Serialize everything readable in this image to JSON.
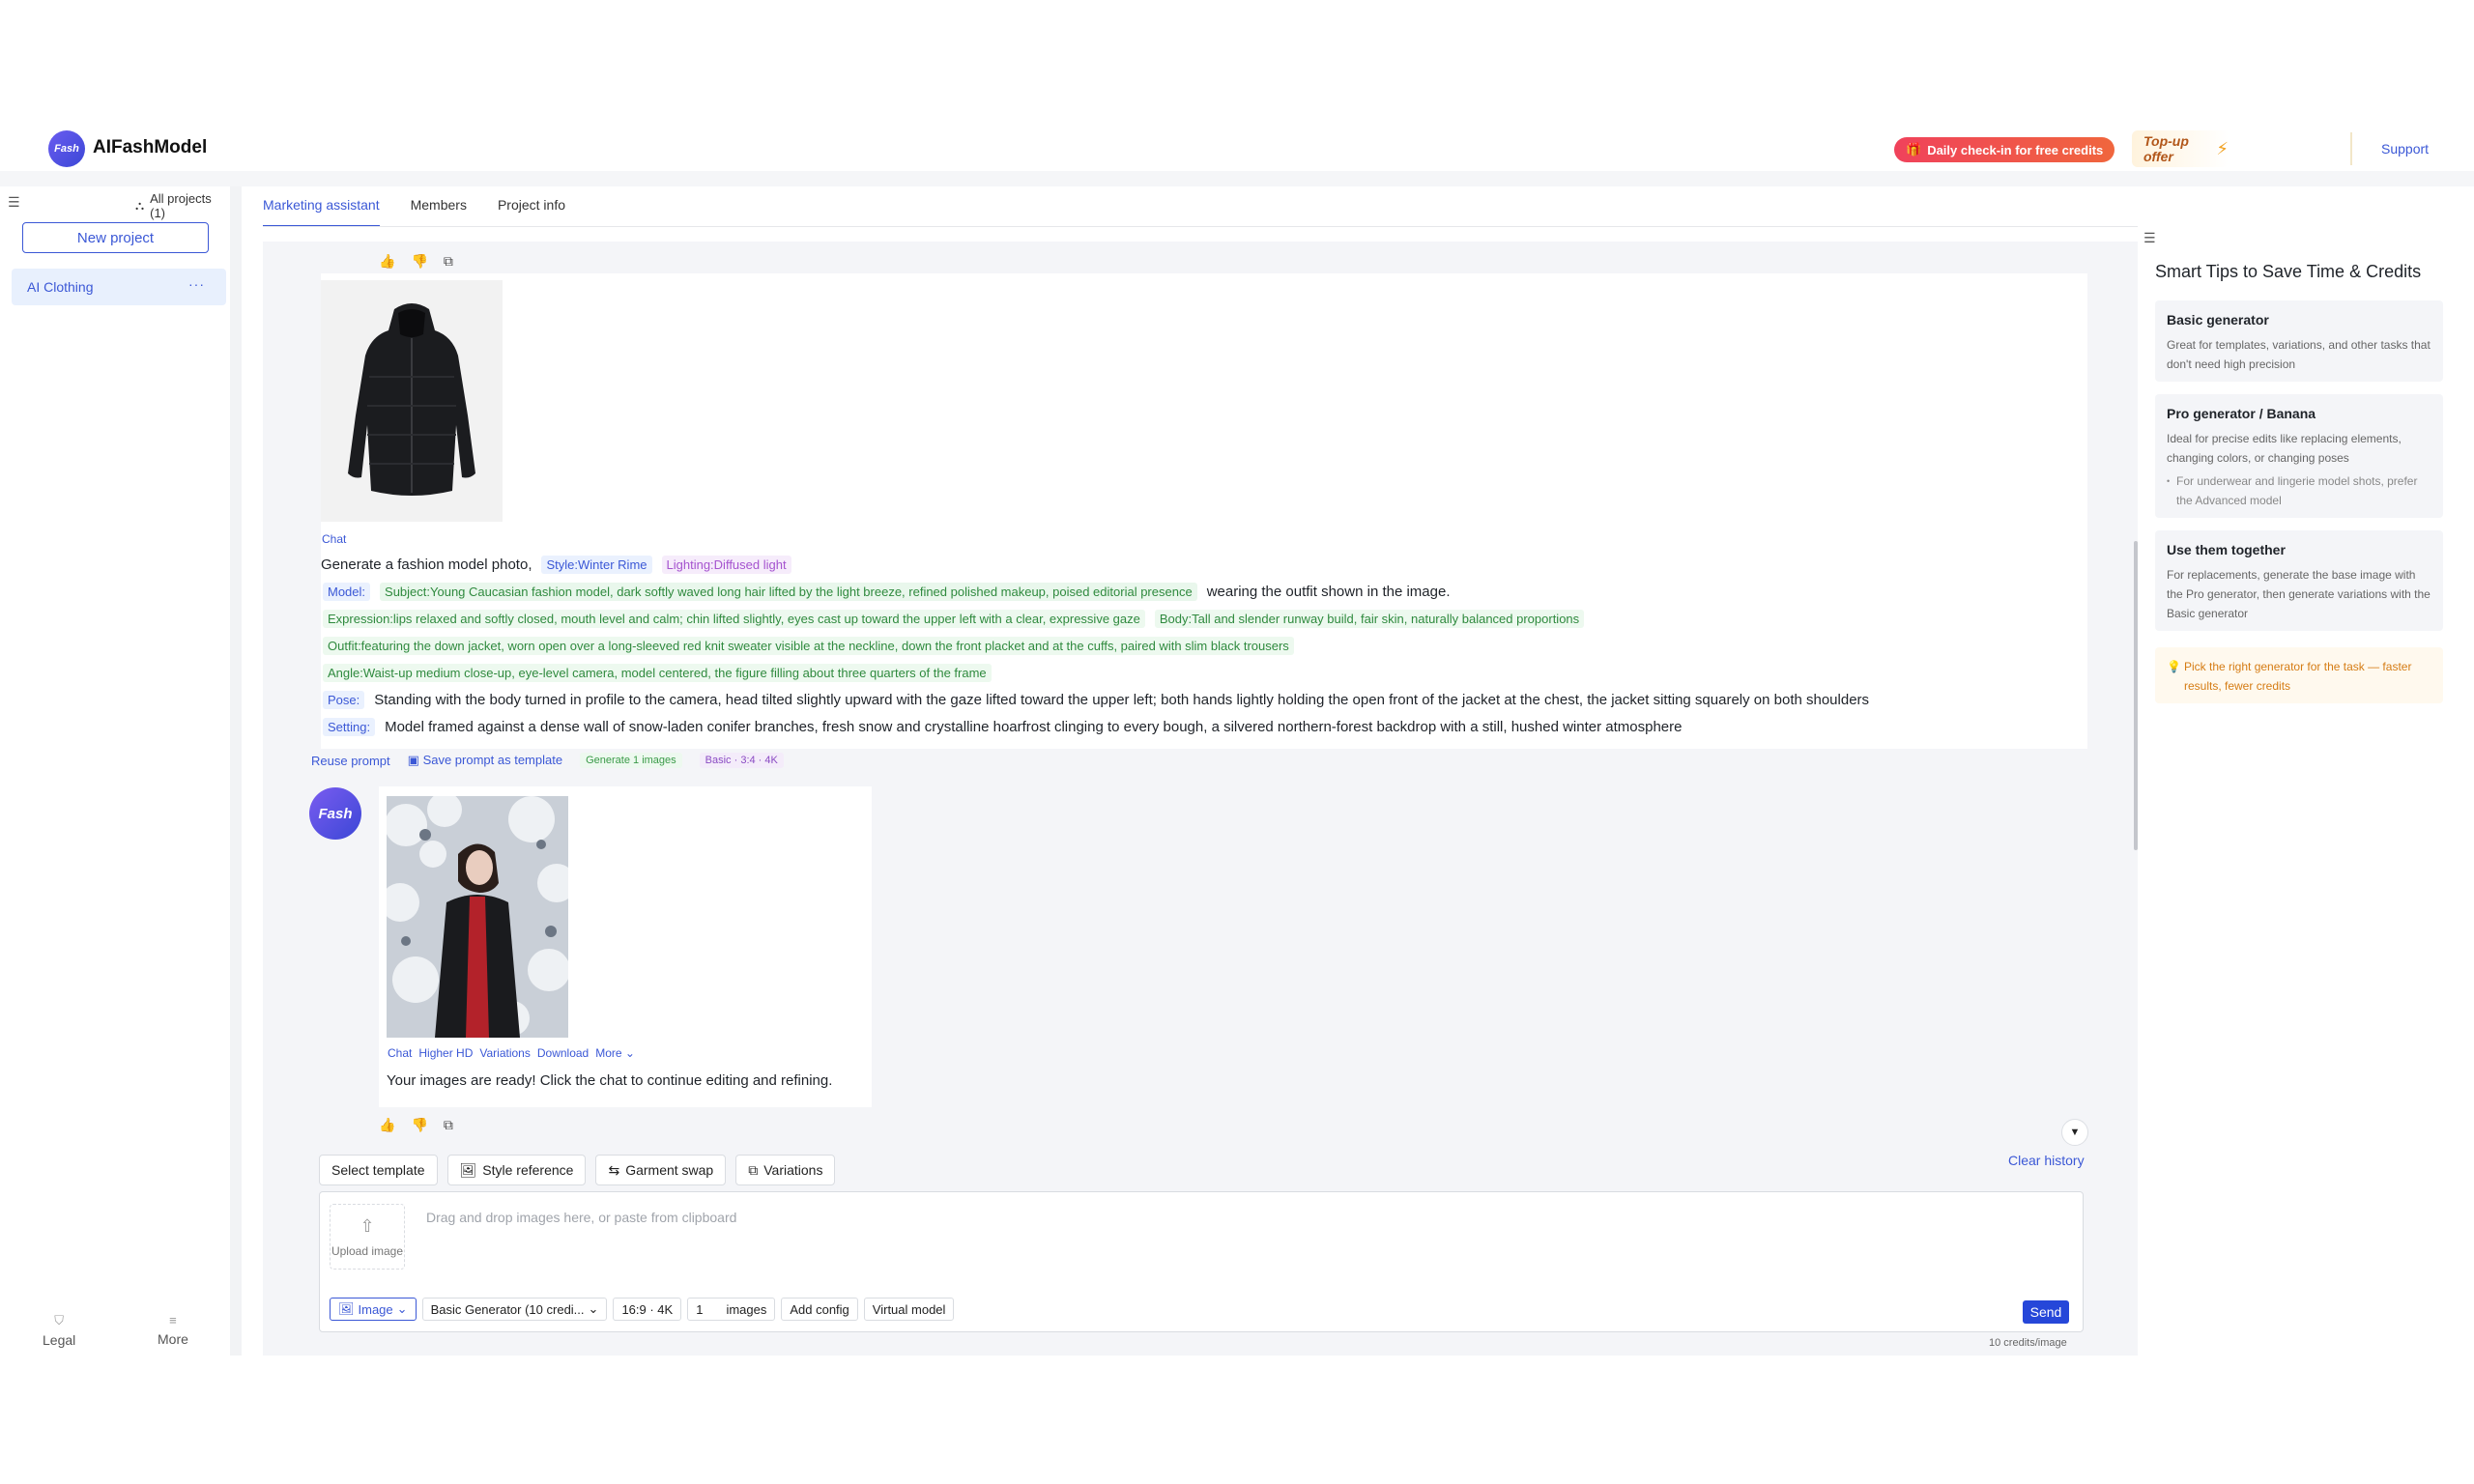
{
  "header": {
    "logo_text": "Fash",
    "brand": "AIFashModel",
    "checkin_label": "Daily check-in for free credits",
    "topup_label": "Top-up offer",
    "support_label": "Support"
  },
  "sidebar": {
    "all_projects": "All projects (1)",
    "new_project": "New project",
    "projects": [
      {
        "label": "AI Clothing",
        "more": "···"
      }
    ],
    "legal": "Legal",
    "more": "More"
  },
  "tabs": [
    {
      "label": "Marketing assistant",
      "active": true
    },
    {
      "label": "Members",
      "active": false
    },
    {
      "label": "Project info",
      "active": false
    }
  ],
  "conversation": {
    "user": {
      "chat_link": "Chat",
      "intro": "Generate a fashion model photo,",
      "style_tag": "Style:Winter Rime",
      "lighting_tag": "Lighting:Diffused light",
      "model_label": "Model:",
      "subject": "Subject:Young Caucasian fashion model, dark softly waved long hair lifted by the light breeze, refined polished makeup, poised editorial presence",
      "wearing": "wearing the outfit shown in the image.",
      "expression": "Expression:lips relaxed and softly closed, mouth level and calm; chin lifted slightly, eyes cast up toward the upper left with a clear, expressive gaze",
      "body": "Body:Tall and slender runway build, fair skin, naturally balanced proportions",
      "outfit": "Outfit:featuring the down jacket, worn open over a long-sleeved red knit sweater visible at the neckline, down the front placket and at the cuffs, paired with slim black trousers",
      "angle": "Angle:Waist-up medium close-up, eye-level camera, model centered, the figure filling about three quarters of the frame",
      "pose_label": "Pose:",
      "pose": "Standing with the body turned in profile to the camera, head tilted slightly upward with the gaze lifted toward the upper left; both hands lightly holding the open front of the jacket at the chest, the jacket sitting squarely on both shoulders",
      "setting_label": "Setting:",
      "setting": "Model framed against a dense wall of snow-laden conifer branches, fresh snow and crystalline hoarfrost clinging to every bough, a silvered northern-forest backdrop with a still, hushed winter atmosphere"
    },
    "actions": {
      "reuse": "Reuse prompt",
      "save_template": "Save prompt as template",
      "generate_badge": "Generate 1 images",
      "quality_badge": "Basic · 3:4 · 4K"
    },
    "bot": {
      "avatar": "Fash",
      "result_actions": [
        "Chat",
        "Higher HD",
        "Variations",
        "Download",
        "More"
      ],
      "message": "Your images are ready! Click the chat to continue editing and refining."
    }
  },
  "composer": {
    "tools": [
      "Select template",
      "Style reference",
      "Garment swap",
      "Variations"
    ],
    "clear_history": "Clear history",
    "upload_label": "Upload image",
    "drop_placeholder": "Drag and drop images here, or paste from clipboard",
    "mode": "Image",
    "generator": "Basic Generator (10 credi...",
    "ratio": "16:9 · 4K",
    "count": "1",
    "count_unit": "images",
    "add_config": "Add config",
    "virtual_model": "Virtual model",
    "send": "Send",
    "credits_note": "10 credits/image"
  },
  "tips": {
    "title": "Smart Tips to Save Time & Credits",
    "cards": [
      {
        "title": "Basic generator",
        "body": "Great for templates, variations, and other tasks that don't need high precision"
      },
      {
        "title": "Pro generator / Banana",
        "body": "Ideal for precise edits like replacing elements, changing colors, or changing poses",
        "note": "For underwear and lingerie model shots, prefer the Advanced model"
      },
      {
        "title": "Use them together",
        "body": "For replacements, generate the base image with the Pro generator, then generate variations with the Basic generator"
      }
    ],
    "warning": "Pick the right generator for the task — faster results, fewer credits"
  },
  "colors": {
    "accent": "#3b58d6",
    "send": "#2647d9",
    "checkin_start": "#f0425b",
    "checkin_end": "#f0663d"
  }
}
